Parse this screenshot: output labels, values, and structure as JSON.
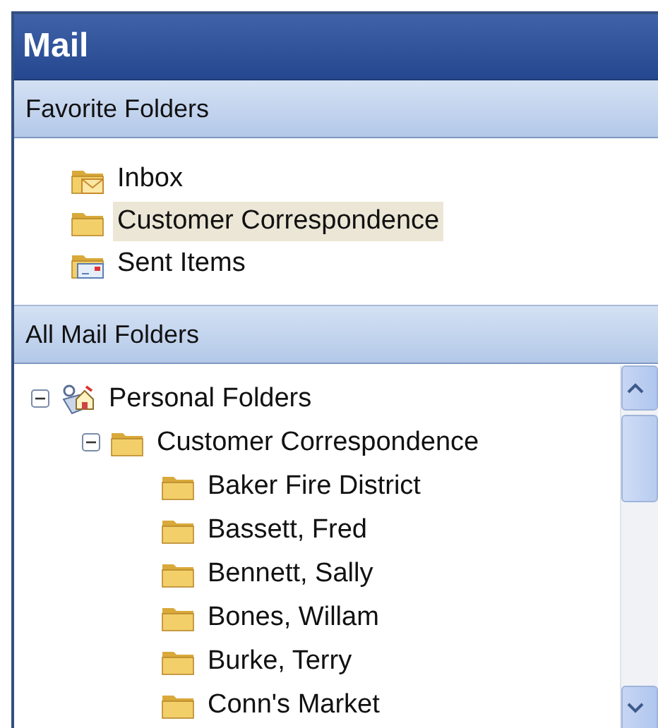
{
  "pane": {
    "title": "Mail"
  },
  "favorites": {
    "heading": "Favorite Folders",
    "items": [
      {
        "label": "Inbox",
        "kind": "inbox",
        "selected": false
      },
      {
        "label": "Customer Correspondence",
        "kind": "folder",
        "selected": true
      },
      {
        "label": "Sent Items",
        "kind": "sent",
        "selected": false
      }
    ]
  },
  "all_folders": {
    "heading": "All Mail Folders",
    "tree": [
      {
        "label": "Personal Folders",
        "kind": "personal",
        "expanded": true,
        "children": [
          {
            "label": "Customer Correspondence",
            "kind": "folder",
            "expanded": true,
            "children": [
              {
                "label": "Baker Fire District",
                "kind": "folder"
              },
              {
                "label": "Bassett, Fred",
                "kind": "folder"
              },
              {
                "label": "Bennett, Sally",
                "kind": "folder"
              },
              {
                "label": "Bones, Willam",
                "kind": "folder"
              },
              {
                "label": "Burke, Terry",
                "kind": "folder"
              },
              {
                "label": "Conn's Market",
                "kind": "folder"
              }
            ]
          }
        ]
      }
    ]
  }
}
